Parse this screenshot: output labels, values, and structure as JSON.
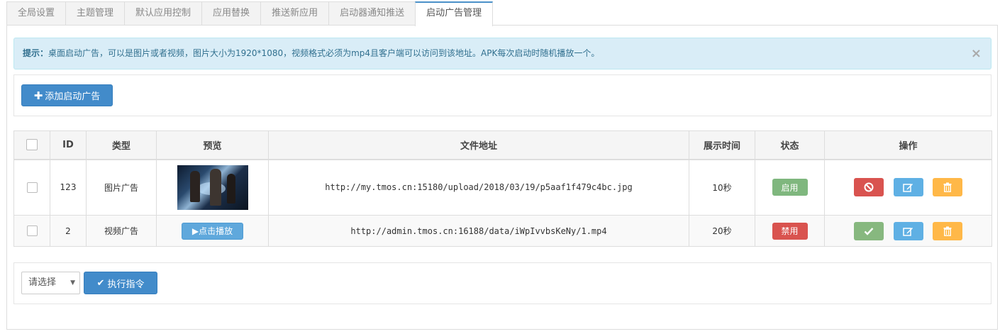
{
  "tabs": [
    {
      "label": "全局设置"
    },
    {
      "label": "主题管理"
    },
    {
      "label": "默认应用控制"
    },
    {
      "label": "应用替换"
    },
    {
      "label": "推送新应用"
    },
    {
      "label": "启动器通知推送"
    },
    {
      "label": "启动广告管理"
    }
  ],
  "active_tab": 6,
  "alert": {
    "prefix": "提示：",
    "text": "桌面启动广告，可以是图片或者视频，图片大小为1920*1080，视频格式必须为mp4且客户端可以访问到该地址。APK每次启动时随机播放一个。",
    "close": "×"
  },
  "toolbar": {
    "add_icon": "plus-icon",
    "add_label": "添加启动广告"
  },
  "table": {
    "headers": {
      "id": "ID",
      "type": "类型",
      "preview": "预览",
      "url": "文件地址",
      "duration": "展示时间",
      "status": "状态",
      "actions": "操作"
    },
    "rows": [
      {
        "id": "123",
        "type": "图片广告",
        "preview_kind": "image",
        "url": "http://my.tmos.cn:15180/upload/2018/03/19/p5aaf1f479c4bc.jpg",
        "duration": "10秒",
        "status": "启用",
        "status_color": "#7fb77e",
        "toggle_icon": "ban-icon"
      },
      {
        "id": "2",
        "type": "视频广告",
        "preview_kind": "video",
        "preview_label": "▶点击播放",
        "url": "http://admin.tmos.cn:16188/data/iWpIvvbsKeNy/1.mp4",
        "duration": "20秒",
        "status": "禁用",
        "status_color": "#d9534f",
        "toggle_icon": "check-icon"
      }
    ]
  },
  "footer": {
    "select_value": "请选择",
    "exec_label": "执行指令"
  },
  "colors": {
    "primary": "#428bca",
    "alert_bg": "#d9edf7",
    "danger": "#d9534f",
    "info": "#5fb0e4",
    "warning": "#ffb848",
    "success": "#87b87f"
  }
}
